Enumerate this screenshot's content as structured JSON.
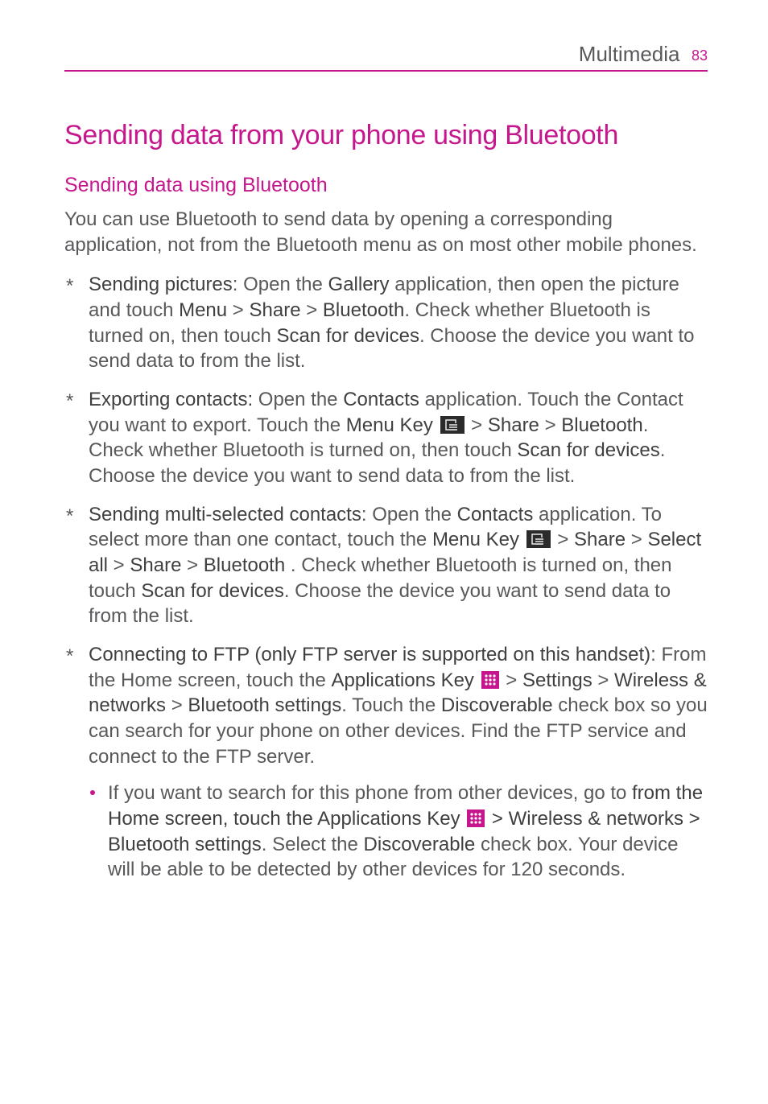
{
  "header": {
    "section": "Multimedia",
    "page": "83"
  },
  "title": "Sending data from your phone using Bluetooth",
  "subtitle": "Sending data using Bluetooth",
  "intro": "You can use Bluetooth to send data by opening a corresponding application, not from the Bluetooth menu as on most other mobile phones.",
  "items": {
    "a": {
      "lead": "Sending pictures",
      "t1": ": Open the ",
      "b1": "Gallery",
      "t2": " application, then open the picture and touch ",
      "b2": "Menu",
      "t3": " > ",
      "b3": "Share",
      "t4": " > ",
      "b4": "Bluetooth",
      "t5": ". Check whether Bluetooth is turned on, then touch ",
      "b5": "Scan for devices",
      "t6": ". Choose the device you want to send data to from the list."
    },
    "b": {
      "lead": "Exporting contacts:",
      "t1": " Open the ",
      "b1": "Contacts",
      "t2": " application. Touch the Contact you want to export. Touch the ",
      "b2": "Menu Key",
      "t3": " > ",
      "b3": "Share",
      "t4": " > ",
      "b4": "Bluetooth",
      "t5": ". Check whether Bluetooth is turned on, then touch ",
      "b5": "Scan for devices",
      "t6": ". Choose the device you want to send data to from the list."
    },
    "c": {
      "lead": "Sending multi-selected contacts",
      "t1": ": Open the ",
      "b1": "Contacts",
      "t2": " application. To select more than one contact, touch the ",
      "b2": "Menu Key",
      "t3": " > ",
      "b3": "Share",
      "t4": " > ",
      "b4": "Select all",
      "t4a": " > ",
      "b4a": "Share",
      "t4b": " > ",
      "b4b": "Bluetooth",
      "t5": " . Check whether Bluetooth is turned on, then touch ",
      "b5": "Scan for devices",
      "t6": ". Choose the device you want to send data to from the list."
    },
    "d": {
      "lead": "Connecting to FTP (only FTP server is supported on this handset)",
      "t1": ": From the Home screen, touch the ",
      "b1": "Applications Key",
      "t2": " > ",
      "b2": "Settings",
      "t3": " > ",
      "b3": "Wireless & networks",
      "t4": " > ",
      "b4": "Bluetooth settings",
      "t5": ". Touch the ",
      "b5": "Discoverable",
      "t6": " check box so you can search for your phone on other devices. Find the FTP service and connect to the FTP server.",
      "sub": {
        "t1": "If you want to search for this phone from other devices, go to ",
        "b1": "from the Home screen, touch the Applications Key ",
        "b2": " > Wireless & networks > Bluetooth settings",
        "t2": ". Select the ",
        "b3": "Discoverable",
        "t3": " check box. Your device will be able to be detected by other devices for 120 seconds."
      }
    }
  }
}
